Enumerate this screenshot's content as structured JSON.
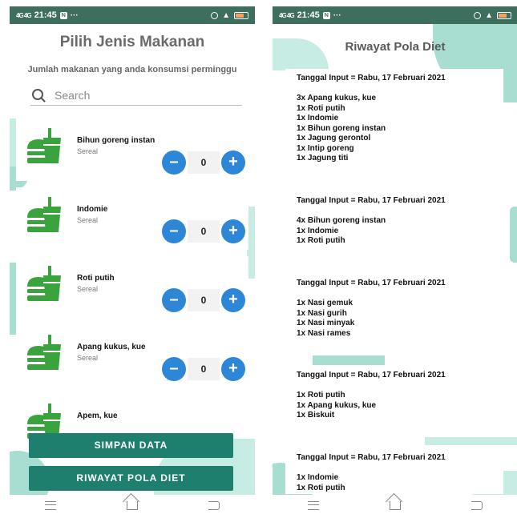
{
  "status_bar": {
    "signal": "4G 4G",
    "time": "21:45",
    "notif_icon": "N",
    "more": "···"
  },
  "screen1": {
    "title": "Pilih Jenis Makanan",
    "subtitle": "Jumlah makanan yang anda konsumsi perminggu",
    "search": {
      "placeholder": "Search"
    },
    "foods": [
      {
        "name": "Bihun goreng instan",
        "category": "Sereal",
        "qty": "0"
      },
      {
        "name": "Indomie",
        "category": "Sereal",
        "qty": "0"
      },
      {
        "name": "Roti putih",
        "category": "Sereal",
        "qty": "0"
      },
      {
        "name": "Apang kukus, kue",
        "category": "Sereal",
        "qty": "0"
      },
      {
        "name": "Apem, kue"
      }
    ],
    "buttons": {
      "save": "SIMPAN DATA",
      "history": "RIWAYAT POLA DIET"
    }
  },
  "screen2": {
    "title": "Riwayat Pola Diet",
    "entries": [
      {
        "date": "Tanggal Input = Rabu, 17 Februari 2021",
        "items": [
          "3x Apang kukus, kue",
          "1x Roti putih",
          "1x Indomie",
          "1x Bihun goreng instan",
          "1x Jagung gerontol",
          "1x Intip goreng",
          "1x Jagung titi"
        ]
      },
      {
        "date": "Tanggal Input = Rabu, 17 Februari 2021",
        "items": [
          "4x Bihun goreng instan",
          "1x Indomie",
          "1x Roti putih"
        ]
      },
      {
        "date": "Tanggal Input = Rabu, 17 Februari 2021",
        "items": [
          "1x Nasi gemuk",
          "1x Nasi gurih",
          "1x Nasi minyak",
          "1x Nasi rames"
        ]
      },
      {
        "date": "Tanggal Input = Rabu, 17 Februari 2021",
        "items": [
          "1x Roti putih",
          "1x Apang kukus, kue",
          "1x Biskuit"
        ]
      },
      {
        "date": "Tanggal Input = Rabu, 17 Februari 2021",
        "items": [
          "1x Indomie",
          "1x Roti putih"
        ]
      }
    ]
  },
  "colors": {
    "accent_green": "#1f7f6e",
    "stepper_blue": "#2e86d6",
    "icon_green": "#3aa33e",
    "status_bar": "#3e6e5e",
    "blob": "#a8ddd1"
  },
  "icons": {
    "food": "burger-drink-icon",
    "search": "search-icon"
  }
}
